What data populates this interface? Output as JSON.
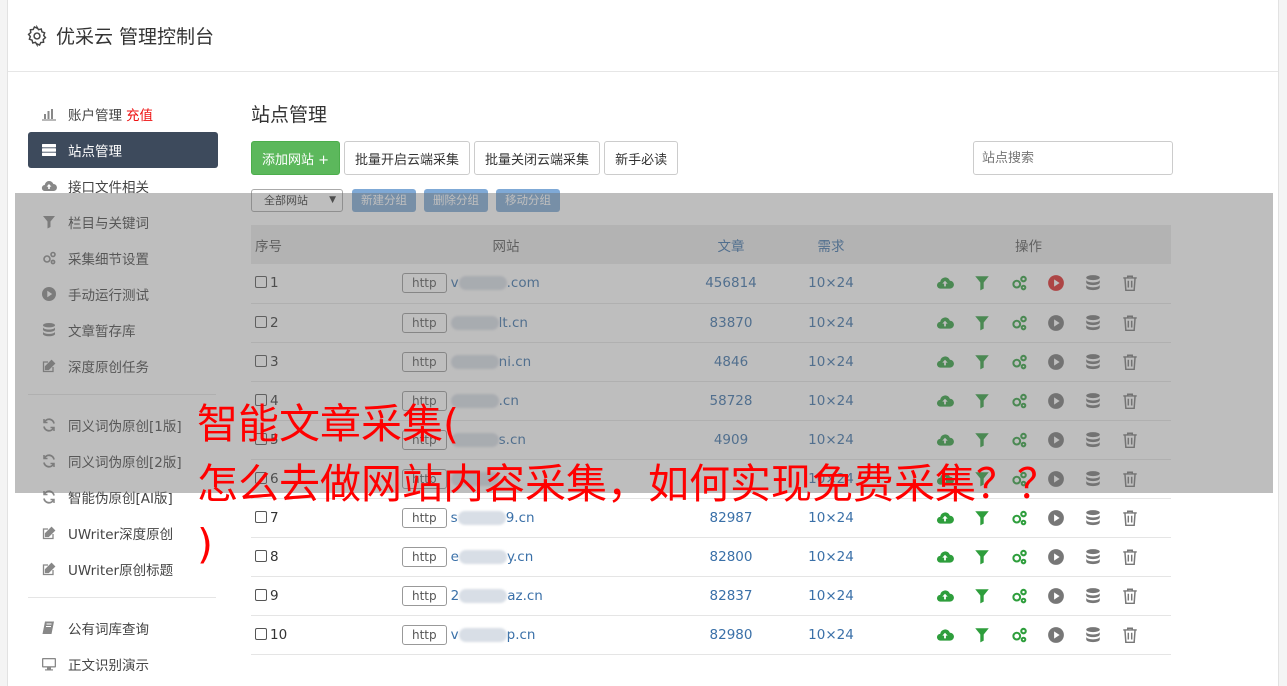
{
  "header": {
    "title": "优采云 管理控制台"
  },
  "sidebar": {
    "group1": [
      {
        "label": "账户管理",
        "badge": "充值",
        "icon": "bar-chart-icon"
      },
      {
        "label": "站点管理",
        "icon": "server-icon",
        "active": true
      },
      {
        "label": "接口文件相关",
        "icon": "cloud-upload-icon"
      },
      {
        "label": "栏目与关键词",
        "icon": "filter-icon"
      },
      {
        "label": "采集细节设置",
        "icon": "gears-icon"
      },
      {
        "label": "手动运行测试",
        "icon": "play-circle-icon"
      },
      {
        "label": "文章暂存库",
        "icon": "database-icon"
      },
      {
        "label": "深度原创任务",
        "icon": "edit-icon"
      }
    ],
    "group2": [
      {
        "label": "同义词伪原创[1版]",
        "icon": "refresh-icon"
      },
      {
        "label": "同义词伪原创[2版]",
        "icon": "refresh-icon"
      },
      {
        "label": "智能伪原创[AI版]",
        "icon": "refresh-icon"
      },
      {
        "label": "UWriter深度原创",
        "icon": "edit-icon"
      },
      {
        "label": "UWriter原创标题",
        "icon": "edit-icon"
      }
    ],
    "group3": [
      {
        "label": "公有词库查询",
        "icon": "book-icon"
      },
      {
        "label": "正文识别演示",
        "icon": "monitor-icon"
      }
    ]
  },
  "main": {
    "title": "站点管理",
    "buttons": {
      "add": "添加网站 +",
      "batch_on": "批量开启云端采集",
      "batch_off": "批量关闭云端采集",
      "guide": "新手必读"
    },
    "search_placeholder": "站点搜索",
    "group_select": "全部网站",
    "group_buttons": {
      "new": "新建分组",
      "delete": "删除分组",
      "move": "移动分组"
    },
    "table": {
      "headers": {
        "no": "序号",
        "site": "网站",
        "articles": "文章",
        "demand": "需求",
        "ops": "操作"
      },
      "rows": [
        {
          "no": "1",
          "protocol": "http",
          "site_prefix": "v",
          "site_suffix": ".com",
          "articles": "456814",
          "demand": "10×24",
          "running": true
        },
        {
          "no": "2",
          "protocol": "http",
          "site_prefix": "",
          "site_suffix": "lt.cn",
          "articles": "83870",
          "demand": "10×24",
          "running": false
        },
        {
          "no": "3",
          "protocol": "http",
          "site_prefix": "",
          "site_suffix": "ni.cn",
          "articles": "4846",
          "demand": "10×24",
          "running": false
        },
        {
          "no": "4",
          "protocol": "http",
          "site_prefix": "",
          "site_suffix": ".cn",
          "articles": "58728",
          "demand": "10×24",
          "running": false
        },
        {
          "no": "5",
          "protocol": "http",
          "site_prefix": "",
          "site_suffix": "s.cn",
          "articles": "4909",
          "demand": "10×24",
          "running": false
        },
        {
          "no": "6",
          "protocol": "http",
          "site_prefix": "",
          "site_suffix": "",
          "articles": "",
          "demand": "10×24",
          "running": false
        },
        {
          "no": "7",
          "protocol": "http",
          "site_prefix": "s",
          "site_suffix": "9.cn",
          "articles": "82987",
          "demand": "10×24",
          "running": false
        },
        {
          "no": "8",
          "protocol": "http",
          "site_prefix": "e",
          "site_suffix": "y.cn",
          "articles": "82800",
          "demand": "10×24",
          "running": false
        },
        {
          "no": "9",
          "protocol": "http",
          "site_prefix": "2",
          "site_suffix": "az.cn",
          "articles": "82837",
          "demand": "10×24",
          "running": false
        },
        {
          "no": "10",
          "protocol": "http",
          "site_prefix": "v",
          "site_suffix": "p.cn",
          "articles": "82980",
          "demand": "10×24",
          "running": false
        }
      ]
    }
  },
  "overlay_caption": {
    "line1": "智能文章采集(",
    "line2": "怎么去做网站内容采集，如何实现免费采集？？",
    "line3": ")"
  },
  "colors": {
    "accent_green": "#5cb85c",
    "sidebar_active": "#3d4a5c",
    "link_blue": "#3a70a8",
    "caption_red": "#ff0000",
    "op_green": "#2e9e3c",
    "run_red": "#e02424"
  }
}
